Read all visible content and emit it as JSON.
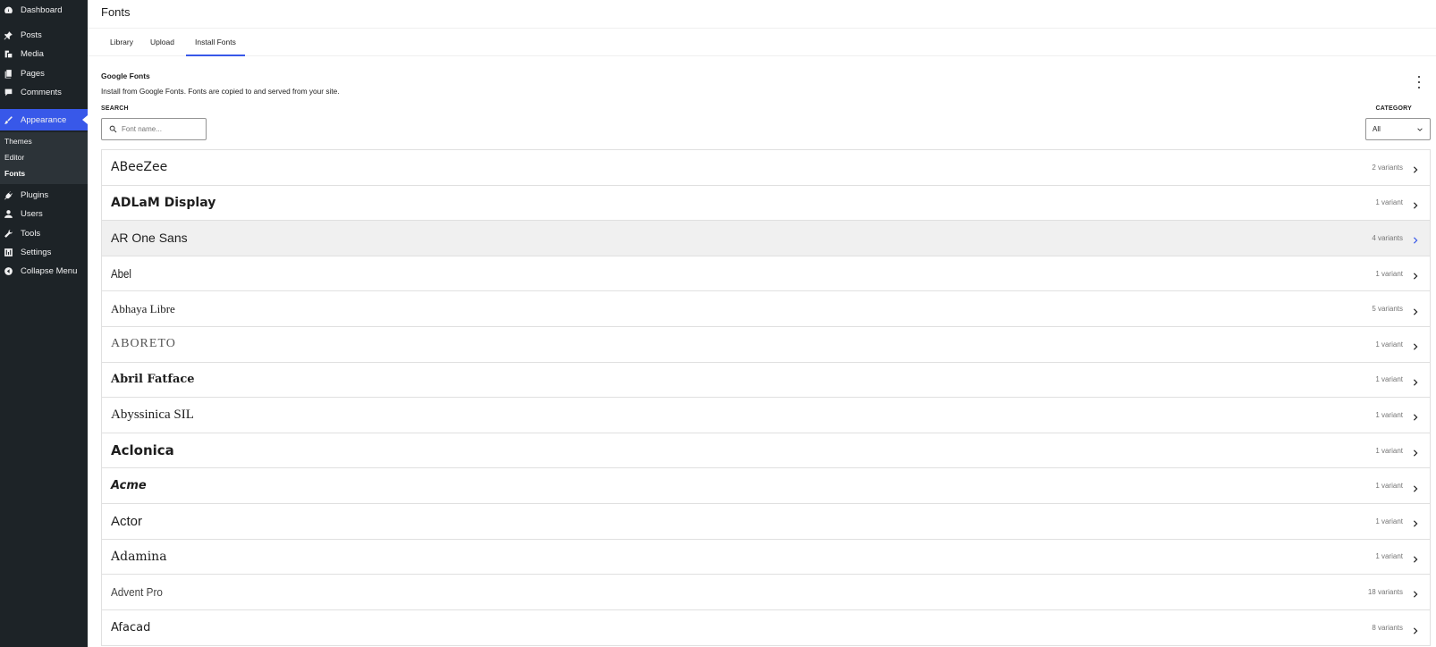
{
  "sidebar": {
    "items": [
      {
        "label": "Dashboard",
        "icon": "dashboard-icon"
      },
      {
        "label": "Posts",
        "icon": "pin-icon"
      },
      {
        "label": "Media",
        "icon": "media-icon"
      },
      {
        "label": "Pages",
        "icon": "pages-icon"
      },
      {
        "label": "Comments",
        "icon": "comment-icon"
      },
      {
        "label": "Appearance",
        "icon": "brush-icon"
      },
      {
        "label": "Plugins",
        "icon": "plugin-icon"
      },
      {
        "label": "Users",
        "icon": "user-icon"
      },
      {
        "label": "Tools",
        "icon": "wrench-icon"
      },
      {
        "label": "Settings",
        "icon": "settings-icon"
      },
      {
        "label": "Collapse Menu",
        "icon": "collapse-icon"
      }
    ],
    "submenu": [
      "Themes",
      "Editor",
      "Fonts"
    ],
    "accent": "#3858e9"
  },
  "header": {
    "title": "Fonts"
  },
  "tabs": [
    "Library",
    "Upload",
    "Install Fonts"
  ],
  "section": {
    "title": "Google Fonts",
    "description": "Install from Google Fonts. Fonts are copied to and served from your site."
  },
  "search": {
    "label": "SEARCH",
    "placeholder": "Font name..."
  },
  "category": {
    "label": "CATEGORY",
    "value": "All"
  },
  "fonts": [
    {
      "name": "ABeeZee",
      "variants": "2 variants"
    },
    {
      "name": "ADLaM Display",
      "variants": "1 variant"
    },
    {
      "name": "AR One Sans",
      "variants": "4 variants"
    },
    {
      "name": "Abel",
      "variants": "1 variant"
    },
    {
      "name": "Abhaya Libre",
      "variants": "5 variants"
    },
    {
      "name": "ABORETO",
      "variants": "1 variant"
    },
    {
      "name": "Abril Fatface",
      "variants": "1 variant"
    },
    {
      "name": "Abyssinica SIL",
      "variants": "1 variant"
    },
    {
      "name": "Aclonica",
      "variants": "1 variant"
    },
    {
      "name": "Acme",
      "variants": "1 variant"
    },
    {
      "name": "Actor",
      "variants": "1 variant"
    },
    {
      "name": "Adamina",
      "variants": "1 variant"
    },
    {
      "name": "Advent Pro",
      "variants": "18 variants"
    },
    {
      "name": "Afacad",
      "variants": "8 variants"
    }
  ]
}
